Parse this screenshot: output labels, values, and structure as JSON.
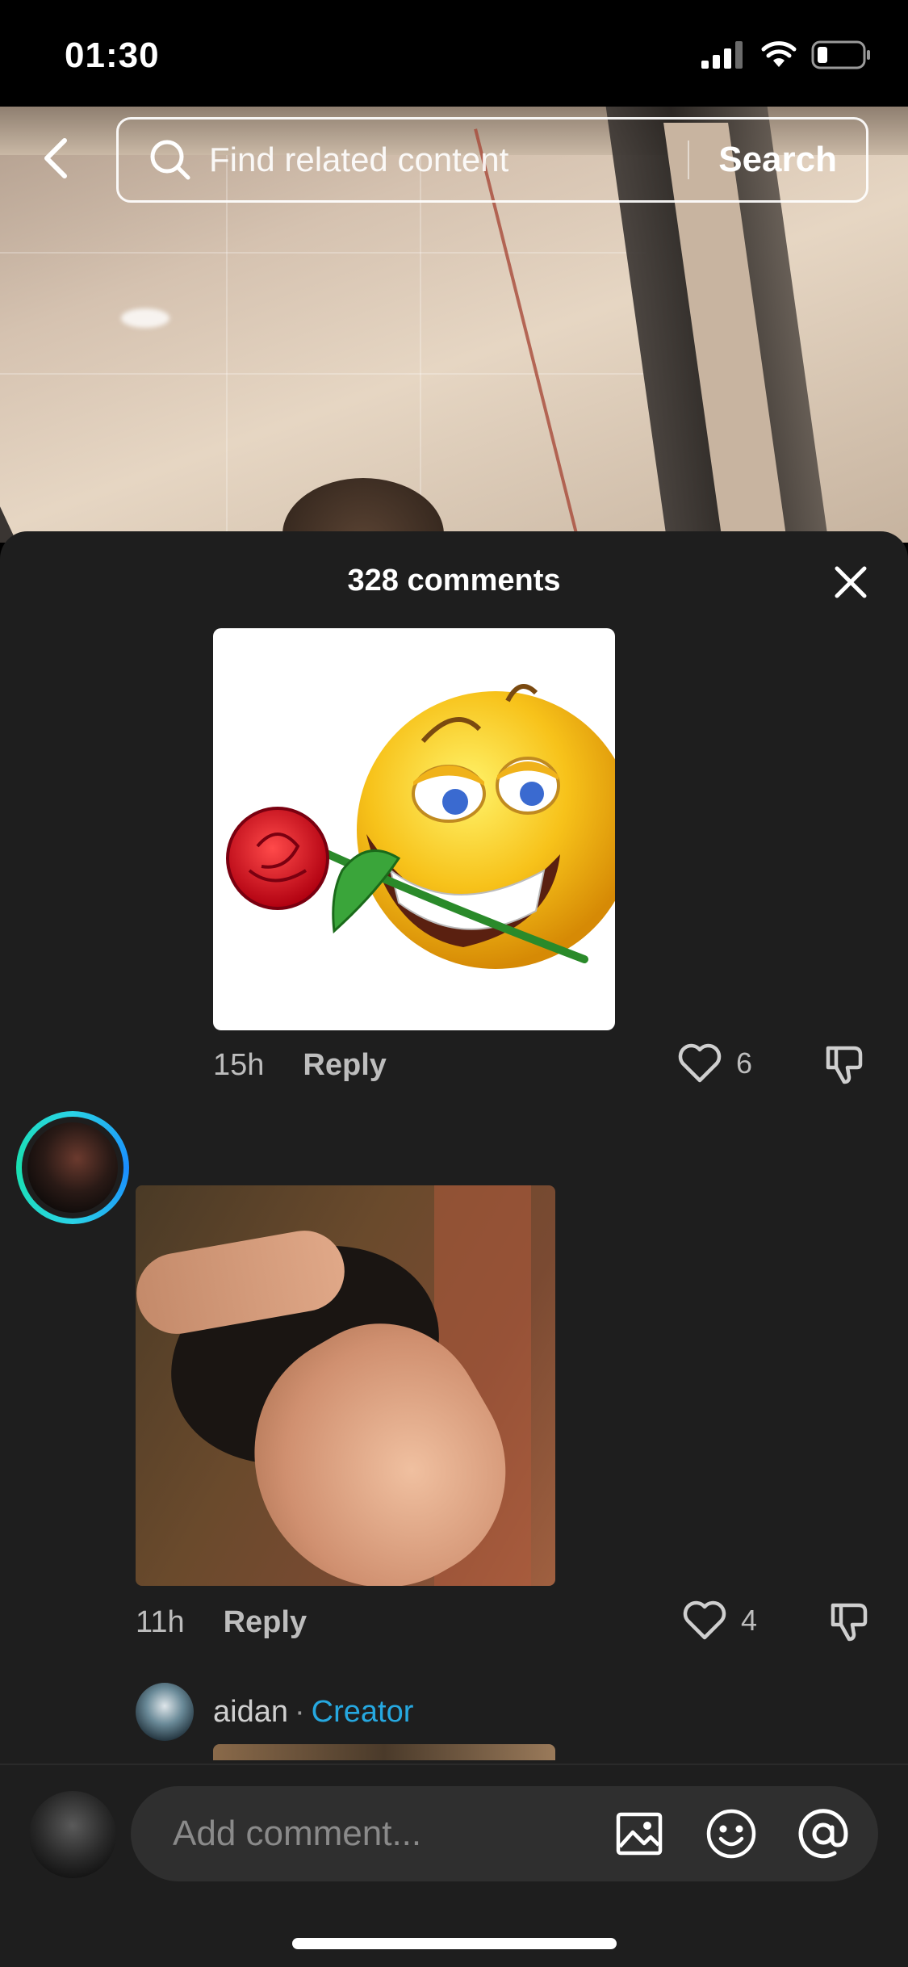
{
  "status_bar": {
    "time": "01:30"
  },
  "search": {
    "placeholder": "Find related content",
    "button_label": "Search"
  },
  "comments_sheet": {
    "title": "328 comments",
    "comments": [
      {
        "time": "15h",
        "reply_label": "Reply",
        "likes": "6"
      },
      {
        "time": "11h",
        "reply_label": "Reply",
        "likes": "4"
      }
    ],
    "partial_comment": {
      "username": "aidan",
      "separator": "·",
      "badge": "Creator"
    }
  },
  "composer": {
    "placeholder": "Add comment..."
  },
  "colors": {
    "sheet_bg": "#1e1e1e",
    "creator_badge": "#26a8e0",
    "accent_ring": "#2ad3e6"
  },
  "icons": [
    "back-icon",
    "search-icon",
    "close-icon",
    "heart-icon",
    "dislike-icon",
    "image-icon",
    "emoji-icon",
    "mention-icon"
  ]
}
